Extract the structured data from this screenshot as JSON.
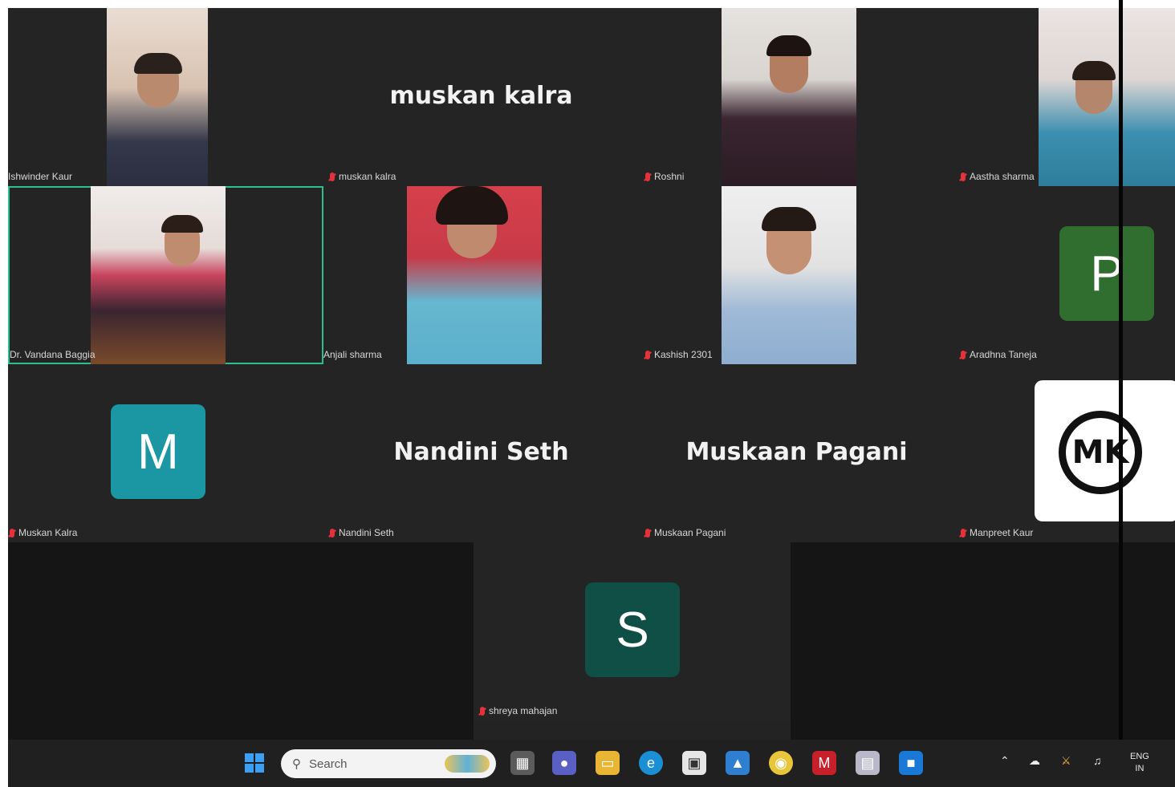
{
  "participants": [
    {
      "id": "t1",
      "label": "Ishwinder Kaur",
      "mic_muted": false
    },
    {
      "id": "t2",
      "label": "muskan kalra",
      "big_name": "muskan kalra",
      "mic_muted": true
    },
    {
      "id": "t3",
      "label": "Roshni",
      "mic_muted": true
    },
    {
      "id": "t4",
      "label": "Aastha sharma",
      "mic_muted": true
    },
    {
      "id": "t5",
      "label": "Dr. Vandana Baggia",
      "mic_muted": false,
      "active_speaker": true
    },
    {
      "id": "t6",
      "label": "Anjali sharma",
      "mic_muted": false
    },
    {
      "id": "t7",
      "label": "Kashish 2301",
      "mic_muted": true
    },
    {
      "id": "t8",
      "label": "Aradhna Taneja",
      "mic_muted": true,
      "avatar_letter": "P",
      "avatar_color": "#2f6e2f"
    },
    {
      "id": "t9",
      "label": "Muskan Kalra",
      "mic_muted": true,
      "avatar_letter": "M",
      "avatar_color": "#1a97a3"
    },
    {
      "id": "t10",
      "label": "Nandini Seth",
      "big_name": "Nandini Seth",
      "mic_muted": true
    },
    {
      "id": "t11",
      "label": "Muskaan Pagani",
      "big_name": "Muskaan Pagani",
      "mic_muted": true
    },
    {
      "id": "t12",
      "label": "Manpreet Kaur",
      "mic_muted": true,
      "avatar_text": "MK"
    },
    {
      "id": "t13",
      "label": "shreya mahajan",
      "mic_muted": true,
      "avatar_letter": "S",
      "avatar_color": "#0f4f45"
    }
  ],
  "taskbar": {
    "search_placeholder": "Search",
    "language": "ENG",
    "region": "IN",
    "icons": [
      "windows-start-icon",
      "search-icon",
      "file-explorer-icon",
      "teams-icon",
      "folder-icon",
      "edge-icon",
      "store-icon",
      "photos-icon",
      "chrome-icon",
      "mcafee-icon",
      "app-icon",
      "chat-icon",
      "chevron-up-icon",
      "cloud-icon",
      "network-icon",
      "volume-icon"
    ]
  },
  "colors": {
    "stage_bg": "#232323",
    "active_border": "#2fbf8c",
    "mic_muted": "#e5323a",
    "taskbar_bg": "#202020"
  }
}
